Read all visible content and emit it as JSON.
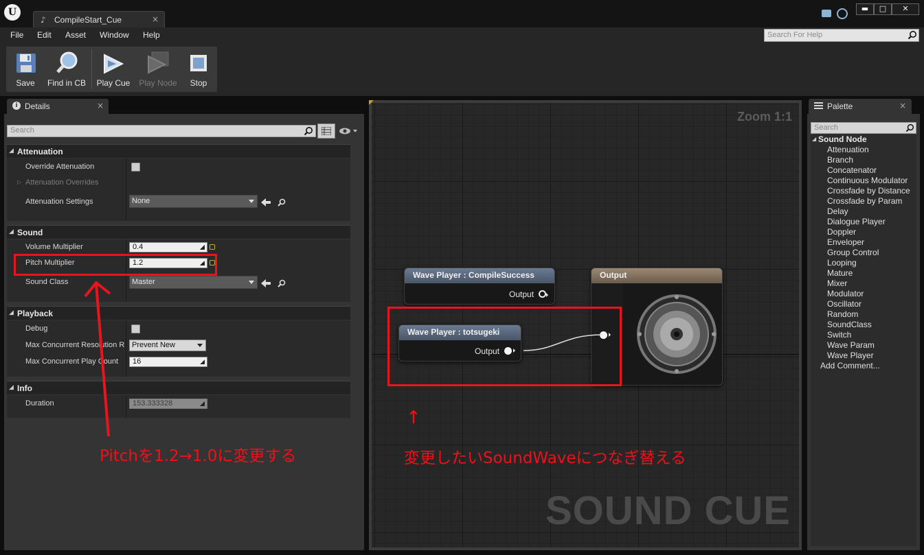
{
  "window": {
    "tab_title": "CompileStart_Cue",
    "tab_close": "×",
    "logo": "U",
    "controls": {
      "minimize": "▬",
      "maximize": "□",
      "close": "✕"
    },
    "icons": [
      "unreal-logo-icon",
      "sound-cue-icon",
      "chat-icon",
      "sync-icon"
    ]
  },
  "menu": {
    "items": [
      "File",
      "Edit",
      "Asset",
      "Window",
      "Help"
    ],
    "help_search_placeholder": "Search For Help"
  },
  "toolbar": {
    "save": "Save",
    "find_in_cb": "Find in CB",
    "play_cue": "Play Cue",
    "play_node": "Play Node",
    "stop": "Stop"
  },
  "details": {
    "tab": "Details",
    "search_placeholder": "Search",
    "sections": {
      "attenuation": {
        "title": "Attenuation",
        "override_attenuation": "Override Attenuation",
        "attenuation_overrides": "Attenuation Overrides",
        "attenuation_settings": "Attenuation Settings",
        "attenuation_settings_value": "None"
      },
      "sound": {
        "title": "Sound",
        "volume_multiplier": "Volume Multiplier",
        "volume_value": "0.4",
        "pitch_multiplier": "Pitch Multiplier",
        "pitch_value": "1.2",
        "sound_class": "Sound Class",
        "sound_class_value": "Master"
      },
      "playback": {
        "title": "Playback",
        "debug": "Debug",
        "max_concurrent_resolution_rule": "Max Concurrent Resolution R",
        "resolution_value": "Prevent New",
        "max_concurrent_play_count": "Max Concurrent Play Count",
        "play_count_value": "16"
      },
      "info": {
        "title": "Info",
        "duration": "Duration",
        "duration_value": "153.333328"
      }
    }
  },
  "graph": {
    "zoom": "Zoom 1:1",
    "watermark": "SOUND CUE",
    "nodes": {
      "compile_success": {
        "title": "Wave Player : CompileSuccess",
        "pin": "Output"
      },
      "totsugeki": {
        "title": "Wave Player : totsugeki",
        "pin": "Output"
      },
      "output": {
        "title": "Output"
      }
    }
  },
  "palette": {
    "tab": "Palette",
    "search_placeholder": "Search",
    "category": "Sound Node",
    "items": [
      "Attenuation",
      "Branch",
      "Concatenator",
      "Continuous Modulator",
      "Crossfade by Distance",
      "Crossfade by Param",
      "Delay",
      "Dialogue Player",
      "Doppler",
      "Enveloper",
      "Group Control",
      "Looping",
      "Mature",
      "Mixer",
      "Modulator",
      "Oscillator",
      "Random",
      "SoundClass",
      "Switch",
      "Wave Param",
      "Wave Player"
    ],
    "add_comment": "Add Comment..."
  },
  "annotations": {
    "pitch_note": "Pitchを1.2→1.0に変更する",
    "swap_arrow": "↑",
    "swap_note": "変更したいSoundWaveにつなぎ替える",
    "color": "#e8141e"
  }
}
